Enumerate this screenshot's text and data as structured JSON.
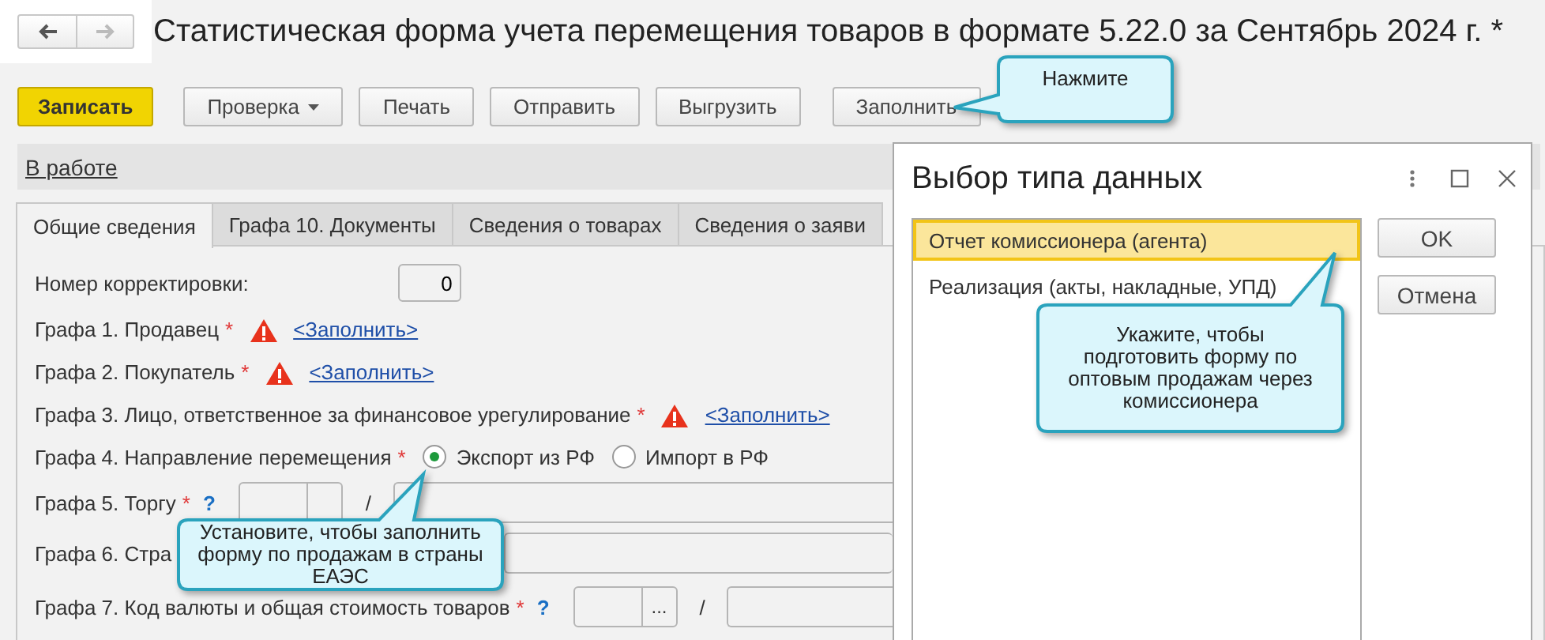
{
  "nav": {
    "back_enabled": true,
    "forward_enabled": false
  },
  "title": "Статистическая форма учета перемещения товаров в формате 5.22.0 за Сентябрь 2024 г. *",
  "toolbar": [
    {
      "label": "Записать",
      "kind": "primary"
    },
    {
      "label": "Проверка",
      "kind": "menu"
    },
    {
      "label": "Печать",
      "kind": "plain"
    },
    {
      "label": "Отправить",
      "kind": "plain"
    },
    {
      "label": "Выгрузить",
      "kind": "plain"
    },
    {
      "label": "Заполнить",
      "kind": "plain"
    }
  ],
  "status_link": "В работе",
  "tabs": [
    {
      "label": "Общие сведения",
      "selected": true
    },
    {
      "label": "Графа 10. Документы",
      "selected": false
    },
    {
      "label": "Сведения о товарах",
      "selected": false
    },
    {
      "label": "Сведения о заяви",
      "selected": false
    }
  ],
  "correction": {
    "label": "Номер корректировки:",
    "value": "0"
  },
  "rows": [
    {
      "kind": "link",
      "label": "Графа 1. Продавец",
      "required_mark": "*",
      "warning": true,
      "link": "<Заполнить>"
    },
    {
      "kind": "link",
      "label": "Графа 2. Покупатель",
      "required_mark": "*",
      "warning": true,
      "link": "<Заполнить>"
    },
    {
      "kind": "link",
      "label": "Графа 3. Лицо, ответственное за финансовое урегулирование",
      "required_mark": "*",
      "warning": true,
      "link": "<Заполнить>"
    },
    {
      "kind": "radio",
      "label": "Графа 4. Направление перемещения",
      "required_mark": "*",
      "options": [
        {
          "label": "Экспорт из РФ",
          "selected": true
        },
        {
          "label": "Импорт в РФ",
          "selected": false
        }
      ]
    },
    {
      "kind": "code",
      "label": "Графа 5. Торгу",
      "required_mark": "*",
      "help": "?",
      "separator": "/"
    },
    {
      "kind": "wide",
      "label": "Графа 6. Стра"
    },
    {
      "kind": "code",
      "label": "Графа 7. Код валюты и общая стоимость товаров",
      "required_mark": "*",
      "help": "?",
      "picker": "...",
      "separator": "/"
    }
  ],
  "dialog": {
    "title": "Выбор типа данных",
    "items": [
      {
        "label": "Отчет комиссионера (агента)",
        "selected": true
      },
      {
        "label": "Реализация (акты, накладные, УПД)",
        "selected": false
      }
    ],
    "buttons": [
      "OK",
      "Отмена"
    ]
  },
  "callouts": [
    {
      "text": "Нажмите"
    },
    {
      "text": "Установите, чтобы заполнить форму по продажам в страны ЕАЭС"
    },
    {
      "text": "Укажите, чтобы подготовить форму по оптовым продажам через комиссионера"
    }
  ]
}
